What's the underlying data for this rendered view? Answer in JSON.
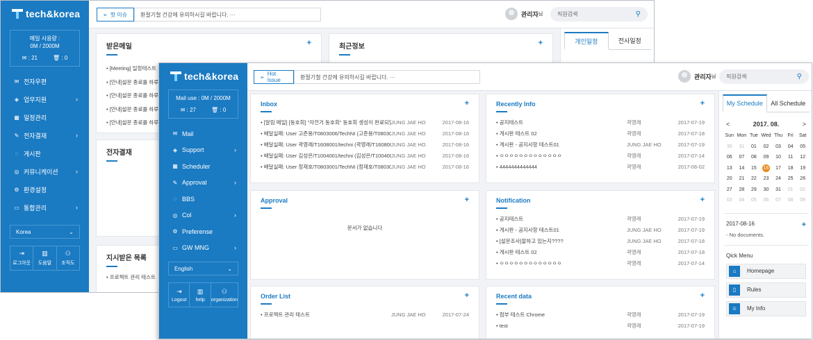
{
  "back": {
    "logo": "tech&korea",
    "usage": {
      "label": "메일 사용량 :",
      "value": "0M / 2000M",
      "mail_count": "21",
      "trash_count": "0"
    },
    "nav": [
      "전자우편",
      "업무지원",
      "일정관리",
      "전자결재",
      "게시판",
      "커뮤니케이션",
      "환경설정",
      "통합관리"
    ],
    "language": "Korea",
    "tools": [
      "로그아웃",
      "도움말",
      "조직도"
    ],
    "issue_label": "핫 이슈",
    "issue_text": "환절기철 건강에 유의하시길 바랍니다. ···",
    "user_name": "관리자",
    "user_suffix": "님",
    "search_placeholder": "직원검색",
    "inbox_title": "받은메일",
    "inbox_rows": [
      "[Meeting] 일정테스트",
      "[안내]설문 종료를 하루",
      "[안내]설문 종료를 하루",
      "[안내]설문 종료를 하루",
      "[안내]설문 종료를 하루"
    ],
    "recent_title": "최근정보",
    "approval_title": "전자결재",
    "received_title": "지시받은 목록",
    "received_rows": [
      "프로젝트 관리 테스트"
    ],
    "tab_personal": "개인일정",
    "tab_all": "전사일정"
  },
  "front": {
    "logo": "tech&korea",
    "usage": {
      "value": "Mail use : 0M / 2000M",
      "mail_count": "27",
      "trash_count": "0"
    },
    "nav": [
      "Mail",
      "Support",
      "Scheduler",
      "Approval",
      "BBS",
      "Col",
      "Preferense",
      "GW MNG"
    ],
    "language": "English",
    "tools": [
      "Logout",
      "help",
      "organization"
    ],
    "issue_label": "Hot Issue",
    "issue_text": "환절기철 건강에 유의하시길 바랍니다. ···",
    "user_name": "관리자",
    "user_suffix": "님",
    "search_placeholder": "직원검색",
    "inbox": {
      "title": "Inbox",
      "rows": [
        {
          "title": "[알림 메일] [동호회] \"자전거 동호회\" 동호회 생성이 완료되었...",
          "author": "JUNG JAE HO",
          "date": "2017-08-16"
        },
        {
          "title": "배달실패: User 고준용/T0803006/TechNI (고준용/T08030...",
          "author": "JUNG JAE HO",
          "date": "2017-08-16"
        },
        {
          "title": "배달실패: User 곽영래/T1608001/techni (곽영래/T160800...",
          "author": "JUNG JAE HO",
          "date": "2017-08-16"
        },
        {
          "title": "배달실패: User 김성은/T1004001/techni (김성은/T100400...",
          "author": "JUNG JAE HO",
          "date": "2017-08-16"
        },
        {
          "title": "배달실패: User 정재호/T0803001/TechNI (정재호/T08030...",
          "author": "JUNG JAE HO",
          "date": "2017-08-16"
        }
      ]
    },
    "recent_info": {
      "title": "Recently Info",
      "rows": [
        {
          "title": "공지테스트",
          "author": "곽영래",
          "date": "2017-07-19"
        },
        {
          "title": "게시판 테스트 02",
          "author": "곽영래",
          "date": "2017-07-18"
        },
        {
          "title": "게시판 - 공지사항 테스트01",
          "author": "JUNG JAE HO",
          "date": "2017-07-19"
        },
        {
          "title": "ㅇㅇㅇㅇㅇㅇㅇㅇㅇㅇㅇㅇㅇ",
          "author": "곽영래",
          "date": "2017-07-14"
        },
        {
          "title": "4444444444444",
          "author": "곽영래",
          "date": "2017-06-02"
        }
      ]
    },
    "approval": {
      "title": "Approval",
      "empty": "문서가 없습니다"
    },
    "notification": {
      "title": "Notification",
      "rows": [
        {
          "title": "공지테스트",
          "author": "곽영래",
          "date": "2017-07-19"
        },
        {
          "title": "게시판 - 공지사항 테스트01",
          "author": "JUNG JAE HO",
          "date": "2017-07-19"
        },
        {
          "title": "[설문조사]잘하고 있는지????",
          "author": "JUNG JAE HO",
          "date": "2017-07-18"
        },
        {
          "title": "게시판 테스트 02",
          "author": "곽영래",
          "date": "2017-07-18"
        },
        {
          "title": "ㅇㅇㅇㅇㅇㅇㅇㅇㅇㅇㅇㅇㅇ",
          "author": "곽영래",
          "date": "2017-07-14"
        }
      ]
    },
    "order_list": {
      "title": "Order List",
      "rows": [
        {
          "title": "프로젝트 관리 테스트",
          "author": "JUNG JAE HO",
          "date": "2017-07-24"
        }
      ]
    },
    "recent_data": {
      "title": "Recent data",
      "rows": [
        {
          "title": "첨부 테스트 Chrome",
          "author": "곽영래",
          "date": "2017-07-19"
        },
        {
          "title": "test",
          "author": "곽영래",
          "date": "2017-07-19"
        }
      ]
    },
    "schedule": {
      "tab_my": "My Schedule",
      "tab_all": "All Schedule",
      "month": "2017. 08.",
      "prev": "<",
      "next": ">",
      "weekdays": [
        "Sun",
        "Mon",
        "Tue",
        "Wed",
        "Thu",
        "Fri",
        "Sat"
      ],
      "weeks": [
        [
          "30",
          "31",
          "01",
          "02",
          "03",
          "04",
          "05"
        ],
        [
          "06",
          "07",
          "08",
          "09",
          "10",
          "11",
          "12"
        ],
        [
          "13",
          "14",
          "15",
          "16",
          "17",
          "18",
          "19"
        ],
        [
          "20",
          "21",
          "22",
          "23",
          "24",
          "25",
          "26"
        ],
        [
          "27",
          "28",
          "29",
          "30",
          "31",
          "01",
          "02"
        ],
        [
          "03",
          "04",
          "05",
          "06",
          "07",
          "08",
          "09"
        ]
      ],
      "selected_date": "2017-08-16",
      "no_docs": "No documents.",
      "quick_title": "Qick Menu",
      "quick": [
        "Homepage",
        "Rules",
        "My Info"
      ]
    }
  }
}
